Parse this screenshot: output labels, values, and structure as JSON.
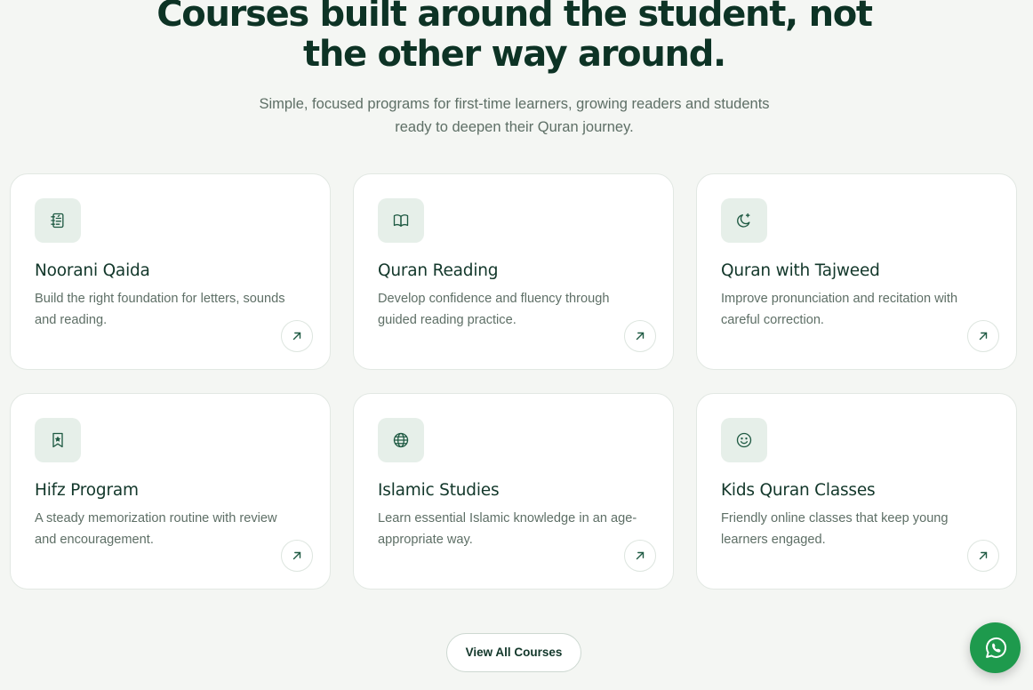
{
  "section": {
    "heading_line1": "Courses built around the student, not",
    "heading_line2": "the other way around.",
    "subtitle_line1": "Simple, focused programs for first-time learners, growing readers and students",
    "subtitle_line2": "ready to deepen their Quran journey."
  },
  "courses": [
    {
      "title": "Noorani Qaida",
      "desc_line1": "Build the right foundation for letters, sounds",
      "desc_line2": "and reading.",
      "icon": "notebook-icon"
    },
    {
      "title": "Quran Reading",
      "desc_line1": "Develop confidence and fluency through",
      "desc_line2": "guided reading practice.",
      "icon": "open-book-icon"
    },
    {
      "title": "Quran with Tajweed",
      "desc_line1": "Improve pronunciation and recitation with",
      "desc_line2": "careful correction.",
      "icon": "crescent-moon-sparkle-icon"
    },
    {
      "title": "Hifz Program",
      "desc_line1": "A steady memorization routine with review",
      "desc_line2": "and encouragement.",
      "icon": "bookmark-star-icon"
    },
    {
      "title": "Islamic Studies",
      "desc_line1": "Learn essential Islamic knowledge in an age-",
      "desc_line2": "appropriate way.",
      "icon": "globe-icon"
    },
    {
      "title": "Kids Quran Classes",
      "desc_line1": "Friendly online classes that keep young",
      "desc_line2": "learners engaged.",
      "icon": "smiley-face-icon"
    }
  ],
  "actions": {
    "view_all_label": "View All Courses",
    "whatsapp_icon": "whatsapp-icon"
  },
  "colors": {
    "background": "#f4f6f3",
    "heading": "#0d3325",
    "accent": "#1f5a43",
    "icon_box": "#e6efe9",
    "whatsapp": "#1e9a4d"
  }
}
